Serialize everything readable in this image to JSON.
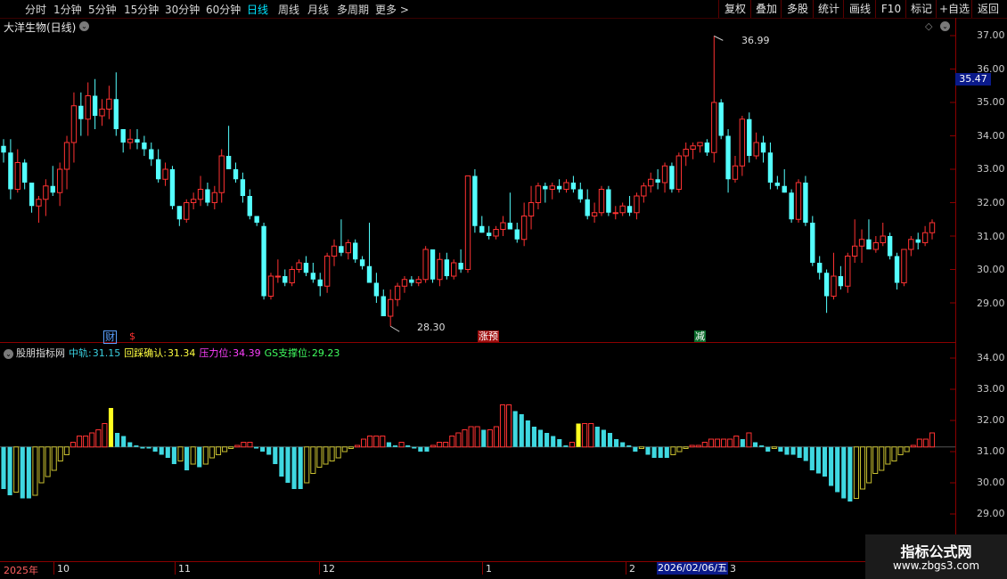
{
  "toolbar": {
    "periods": [
      "分时",
      "1分钟",
      "5分钟",
      "15分钟",
      "30分钟",
      "60分钟",
      "日线",
      "周线",
      "月线",
      "多周期",
      "更多 >"
    ],
    "active_period": "日线",
    "buttons": [
      "复权",
      "叠加",
      "多股",
      "统计",
      "画线",
      "F10",
      "标记",
      "+自选",
      "返回"
    ]
  },
  "stock": {
    "title": "大洋生物(日线)"
  },
  "price_axis": {
    "labels": [
      "37.00",
      "36.00",
      "35.00",
      "34.00",
      "33.00",
      "32.00",
      "31.00",
      "30.00",
      "29.00"
    ],
    "current": "35.47"
  },
  "annotations": {
    "high": "36.99",
    "low": "28.30"
  },
  "events": [
    {
      "label": "财",
      "color": "#5aa0ff"
    },
    {
      "label": "$",
      "color": "#ff3030"
    },
    {
      "label": "涨预",
      "color": "#ffffff",
      "bg": "#a01010"
    },
    {
      "label": "减",
      "color": "#ffffff",
      "bg": "#0b6b2b"
    }
  ],
  "indicator": {
    "name": "股朋指标网",
    "mid_label": "中轨:",
    "mid_value": "31.15",
    "pullback_label": "回踩确认:",
    "pullback_value": "31.34",
    "resist_label": "压力位:",
    "resist_value": "34.39",
    "support_label": "GS支撑位:",
    "support_value": "29.23",
    "axis": [
      "34.00",
      "33.00",
      "32.00",
      "31.00",
      "30.00",
      "29.00"
    ]
  },
  "dates": {
    "year": "2025年",
    "months": [
      "10",
      "11",
      "12",
      "1",
      "2",
      "3"
    ],
    "selected": "2026/02/06/五"
  },
  "watermark": {
    "line1": "指标公式网",
    "line2": "www.zbgs3.com"
  },
  "colors": {
    "up": "#ff3232",
    "down": "#54ffff",
    "grid": "#8b0000",
    "bar_pos": "#3fd8e0",
    "bar_neg_pale": "#c8c030"
  },
  "chart_data": [
    {
      "type": "candlestick",
      "title": "大洋生物(日线)",
      "ylim": [
        28.0,
        37.4
      ],
      "ohlc": [
        [
          33.7,
          33.9,
          33.2,
          33.5
        ],
        [
          33.5,
          33.9,
          32.1,
          32.4
        ],
        [
          32.4,
          33.6,
          32.3,
          33.2
        ],
        [
          33.2,
          33.3,
          32.4,
          32.6
        ],
        [
          32.6,
          32.6,
          31.7,
          31.9
        ],
        [
          31.9,
          32.2,
          31.4,
          32.1
        ],
        [
          32.1,
          32.7,
          31.6,
          32.5
        ],
        [
          32.5,
          33.1,
          32.2,
          32.3
        ],
        [
          32.3,
          33.2,
          31.9,
          33.0
        ],
        [
          33.0,
          34.0,
          32.4,
          33.8
        ],
        [
          33.8,
          35.3,
          33.2,
          34.9
        ],
        [
          34.9,
          35.3,
          34.0,
          34.5
        ],
        [
          34.5,
          35.6,
          34.0,
          35.2
        ],
        [
          35.2,
          35.7,
          34.2,
          34.6
        ],
        [
          34.6,
          35.1,
          34.3,
          34.8
        ],
        [
          34.8,
          35.5,
          34.5,
          35.1
        ],
        [
          35.1,
          35.9,
          34.0,
          34.2
        ],
        [
          34.2,
          34.2,
          33.5,
          33.8
        ],
        [
          33.8,
          34.2,
          33.6,
          33.9
        ],
        [
          33.9,
          34.2,
          33.6,
          33.8
        ],
        [
          33.8,
          34.0,
          33.4,
          33.6
        ],
        [
          33.6,
          33.8,
          33.1,
          33.3
        ],
        [
          33.3,
          33.6,
          32.6,
          32.7
        ],
        [
          32.7,
          33.2,
          32.5,
          33.0
        ],
        [
          33.0,
          33.1,
          31.8,
          31.9
        ],
        [
          31.9,
          31.9,
          31.3,
          31.5
        ],
        [
          31.5,
          32.1,
          31.4,
          32.0
        ],
        [
          32.0,
          32.3,
          31.8,
          32.1
        ],
        [
          32.1,
          32.8,
          31.9,
          32.4
        ],
        [
          32.4,
          32.6,
          31.9,
          32.0
        ],
        [
          32.0,
          32.5,
          31.8,
          32.3
        ],
        [
          32.3,
          33.6,
          32.0,
          33.4
        ],
        [
          33.4,
          34.3,
          33.1,
          33.0
        ],
        [
          33.0,
          33.2,
          32.6,
          32.7
        ],
        [
          32.7,
          32.9,
          32.0,
          32.2
        ],
        [
          32.2,
          32.4,
          31.5,
          31.6
        ],
        [
          31.6,
          31.6,
          31.3,
          31.4
        ],
        [
          31.3,
          31.4,
          29.1,
          29.2
        ],
        [
          29.2,
          29.9,
          29.1,
          29.8
        ],
        [
          29.8,
          30.3,
          29.6,
          29.8
        ],
        [
          29.8,
          30.0,
          29.5,
          29.6
        ],
        [
          29.6,
          30.1,
          29.5,
          30.0
        ],
        [
          30.0,
          30.3,
          29.9,
          30.2
        ],
        [
          30.2,
          30.4,
          29.8,
          29.9
        ],
        [
          29.9,
          30.2,
          29.6,
          29.7
        ],
        [
          29.7,
          29.9,
          29.2,
          29.5
        ],
        [
          29.5,
          30.5,
          29.3,
          30.4
        ],
        [
          30.4,
          30.9,
          30.1,
          30.7
        ],
        [
          30.7,
          31.5,
          30.4,
          30.5
        ],
        [
          30.5,
          30.9,
          30.3,
          30.8
        ],
        [
          30.8,
          30.9,
          30.2,
          30.3
        ],
        [
          30.3,
          30.4,
          30.0,
          30.1
        ],
        [
          30.1,
          31.4,
          29.6,
          29.6
        ],
        [
          29.6,
          29.9,
          29.0,
          29.2
        ],
        [
          29.2,
          29.4,
          28.6,
          28.6
        ],
        [
          28.6,
          29.4,
          28.3,
          29.1
        ],
        [
          29.1,
          29.6,
          28.9,
          29.5
        ],
        [
          29.5,
          29.8,
          29.3,
          29.7
        ],
        [
          29.7,
          29.8,
          29.5,
          29.6
        ],
        [
          29.6,
          29.8,
          29.5,
          29.7
        ],
        [
          29.7,
          30.7,
          29.6,
          30.6
        ],
        [
          30.6,
          30.6,
          29.6,
          29.7
        ],
        [
          29.7,
          30.5,
          29.5,
          30.3
        ],
        [
          30.3,
          30.5,
          29.7,
          29.8
        ],
        [
          29.8,
          30.3,
          29.7,
          30.2
        ],
        [
          30.2,
          30.6,
          29.9,
          30.0
        ],
        [
          30.0,
          32.8,
          29.9,
          32.8
        ],
        [
          32.8,
          33.0,
          31.1,
          31.3
        ],
        [
          31.3,
          31.6,
          31.1,
          31.1
        ],
        [
          31.1,
          31.3,
          30.9,
          31.0
        ],
        [
          31.0,
          31.3,
          30.9,
          31.2
        ],
        [
          31.2,
          31.6,
          31.0,
          31.4
        ],
        [
          31.4,
          32.3,
          31.2,
          31.2
        ],
        [
          31.2,
          31.4,
          30.8,
          30.9
        ],
        [
          30.9,
          32.0,
          30.7,
          31.6
        ],
        [
          31.6,
          32.5,
          31.2,
          32.0
        ],
        [
          32.0,
          32.6,
          31.8,
          32.5
        ],
        [
          32.5,
          32.6,
          32.0,
          32.4
        ],
        [
          32.4,
          32.6,
          32.1,
          32.5
        ],
        [
          32.5,
          32.7,
          32.3,
          32.4
        ],
        [
          32.4,
          32.7,
          32.3,
          32.6
        ],
        [
          32.6,
          32.8,
          32.3,
          32.4
        ],
        [
          32.4,
          32.6,
          32.0,
          32.1
        ],
        [
          32.1,
          32.4,
          31.5,
          31.6
        ],
        [
          31.6,
          32.0,
          31.4,
          31.7
        ],
        [
          31.7,
          32.5,
          31.6,
          32.4
        ],
        [
          32.4,
          32.5,
          31.6,
          31.7
        ],
        [
          31.7,
          31.9,
          31.5,
          31.7
        ],
        [
          31.7,
          32.0,
          31.6,
          31.9
        ],
        [
          31.9,
          32.2,
          31.6,
          31.7
        ],
        [
          31.7,
          32.3,
          31.5,
          32.2
        ],
        [
          32.2,
          32.6,
          32.0,
          32.5
        ],
        [
          32.5,
          32.9,
          32.3,
          32.7
        ],
        [
          32.7,
          33.0,
          32.4,
          32.6
        ],
        [
          32.6,
          33.2,
          32.3,
          33.1
        ],
        [
          33.1,
          33.2,
          32.3,
          32.4
        ],
        [
          32.4,
          33.5,
          32.3,
          33.4
        ],
        [
          33.4,
          33.8,
          33.1,
          33.6
        ],
        [
          33.6,
          33.8,
          33.3,
          33.7
        ],
        [
          33.7,
          33.8,
          33.5,
          33.8
        ],
        [
          33.8,
          33.9,
          33.4,
          33.5
        ],
        [
          33.5,
          36.99,
          33.2,
          35.0
        ],
        [
          35.0,
          35.1,
          33.9,
          34.0
        ],
        [
          34.0,
          34.2,
          32.3,
          32.7
        ],
        [
          32.7,
          33.4,
          32.6,
          33.1
        ],
        [
          33.1,
          34.6,
          32.8,
          34.5
        ],
        [
          34.5,
          34.7,
          33.2,
          33.4
        ],
        [
          33.4,
          34.1,
          33.3,
          33.8
        ],
        [
          33.8,
          34.0,
          33.2,
          33.5
        ],
        [
          33.5,
          33.8,
          32.4,
          32.6
        ],
        [
          32.6,
          32.8,
          32.4,
          32.5
        ],
        [
          32.5,
          33.0,
          32.3,
          32.3
        ],
        [
          32.3,
          32.4,
          31.4,
          31.5
        ],
        [
          31.5,
          32.7,
          31.4,
          32.6
        ],
        [
          32.6,
          32.8,
          31.3,
          31.4
        ],
        [
          31.4,
          31.6,
          30.1,
          30.2
        ],
        [
          30.2,
          30.4,
          29.7,
          29.9
        ],
        [
          29.9,
          30.0,
          28.7,
          29.2
        ],
        [
          29.2,
          30.5,
          29.1,
          29.8
        ],
        [
          29.8,
          30.1,
          29.4,
          29.5
        ],
        [
          29.5,
          30.5,
          29.3,
          30.4
        ],
        [
          30.4,
          31.5,
          30.2,
          30.7
        ],
        [
          30.7,
          31.2,
          30.2,
          30.9
        ],
        [
          30.9,
          31.5,
          30.6,
          30.6
        ],
        [
          30.6,
          31.0,
          30.5,
          30.8
        ],
        [
          30.8,
          31.4,
          30.7,
          31.0
        ],
        [
          31.0,
          31.1,
          30.3,
          30.4
        ],
        [
          30.4,
          30.5,
          29.4,
          29.6
        ],
        [
          29.6,
          30.5,
          29.5,
          30.6
        ],
        [
          30.6,
          31.0,
          30.4,
          30.9
        ],
        [
          30.9,
          31.1,
          30.6,
          30.8
        ],
        [
          30.8,
          31.3,
          30.7,
          31.1
        ],
        [
          31.1,
          31.5,
          30.9,
          31.4
        ]
      ]
    },
    {
      "type": "bar",
      "title": "股朋指标网",
      "ylim": [
        28.2,
        34.6
      ],
      "base": 31.15,
      "values": [
        29.8,
        29.6,
        29.7,
        29.5,
        29.5,
        29.6,
        30.0,
        30.2,
        30.4,
        30.7,
        30.9,
        31.3,
        31.5,
        31.5,
        31.6,
        31.7,
        31.9,
        32.4,
        31.6,
        31.5,
        31.3,
        31.2,
        31.1,
        31.1,
        31.0,
        30.9,
        30.8,
        30.6,
        30.7,
        30.4,
        30.6,
        30.5,
        30.6,
        30.8,
        30.9,
        31.0,
        31.1,
        31.2,
        31.3,
        31.3,
        31.1,
        31.0,
        30.9,
        30.6,
        30.2,
        30.0,
        29.8,
        29.8,
        30.0,
        30.3,
        30.5,
        30.6,
        30.7,
        30.8,
        31.0,
        31.1,
        31.2,
        31.4,
        31.5,
        31.5,
        31.5,
        31.3,
        31.2,
        31.3,
        31.2,
        31.1,
        31.0,
        31.0,
        31.2,
        31.3,
        31.3,
        31.5,
        31.6,
        31.7,
        31.8,
        31.8,
        31.7,
        31.7,
        31.8,
        32.5,
        32.5,
        32.3,
        32.2,
        32.0,
        31.8,
        31.7,
        31.6,
        31.5,
        31.4,
        31.2,
        31.3,
        31.9,
        31.9,
        31.9,
        31.8,
        31.7,
        31.6,
        31.4,
        31.3,
        31.2,
        31.0,
        31.1,
        30.9,
        30.8,
        30.8,
        30.8,
        30.9,
        31.0,
        31.1,
        31.2,
        31.2,
        31.3,
        31.4,
        31.4,
        31.4,
        31.4,
        31.5,
        31.4,
        31.6,
        31.3,
        31.2,
        31.0,
        31.1,
        31.0,
        30.9,
        30.9,
        30.8,
        30.7,
        30.4,
        30.3,
        30.2,
        29.9,
        29.7,
        29.5,
        29.4,
        29.5,
        29.8,
        30.0,
        30.3,
        30.4,
        30.6,
        30.7,
        30.9,
        31.0,
        31.2,
        31.4,
        31.4,
        31.6
      ]
    }
  ]
}
